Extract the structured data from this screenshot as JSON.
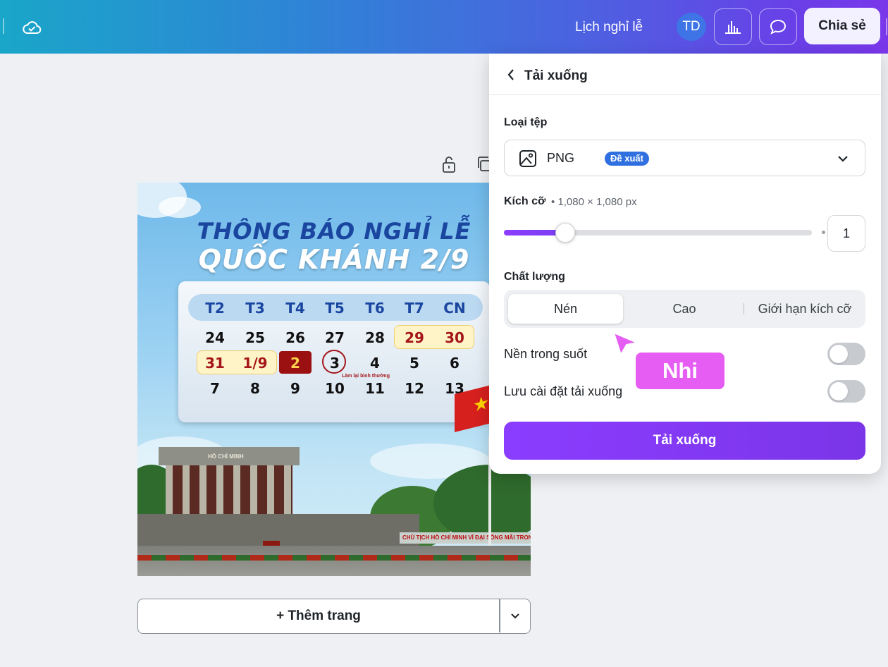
{
  "topbar": {
    "doc_title": "Lịch nghỉ lễ",
    "avatar_initials": "TD",
    "share_label": "Chia sẻ"
  },
  "poster": {
    "title_line1": "THÔNG BÁO NGHỈ LỄ",
    "title_line2": "QUỐC KHÁNH 2/9",
    "weekdays": [
      "T2",
      "T3",
      "T4",
      "T5",
      "T6",
      "T7",
      "CN"
    ],
    "week1": [
      "24",
      "25",
      "26",
      "27",
      "28",
      "29",
      "30"
    ],
    "week2": [
      "31",
      "1/9",
      "2",
      "3",
      "4",
      "5",
      "6"
    ],
    "week3": [
      "7",
      "8",
      "9",
      "10",
      "11",
      "12",
      "13"
    ],
    "note": "Làm lại bình thường",
    "building_sign": "HỒ CHÍ MINH",
    "banner": "CHỦ TỊCH HỒ CHÍ MINH VĨ ĐẠI SỐNG MÃI TRONG S"
  },
  "add_page": {
    "label": "+ Thêm trang"
  },
  "download_panel": {
    "title": "Tải xuống",
    "file_type_label": "Loại tệp",
    "file_type_value": "PNG",
    "file_type_badge": "Đề xuất",
    "size_label": "Kích cỡ",
    "size_note": "• 1,080 × 1,080 px",
    "size_multiplier": "1",
    "size_slider_fraction": 0.2,
    "quality_label": "Chất lượng",
    "quality_options": [
      "Nén",
      "Cao",
      "Giới hạn kích cỡ"
    ],
    "quality_selected": "Nén",
    "transparent_bg_label": "Nền trong suốt",
    "transparent_bg_on": false,
    "save_settings_label": "Lưu cài đặt tải xuống",
    "save_settings_on": false,
    "download_button": "Tải xuống"
  },
  "collaborator": {
    "name": "Nhi",
    "color": "#e55df2"
  },
  "colors": {
    "accent": "#8b3dff",
    "badge": "#2f6fe0"
  }
}
